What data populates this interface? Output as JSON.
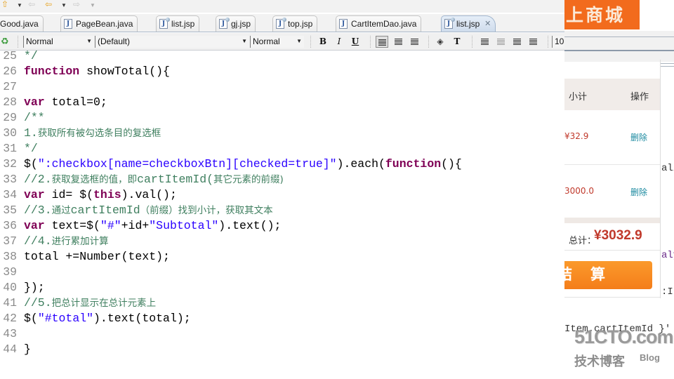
{
  "nav_toolbar": {
    "icons": [
      "up-arrow-icon",
      "back-arrow-icon",
      "forward-arrow-icon"
    ]
  },
  "tabs": [
    {
      "label": "Good.java",
      "type": "java",
      "active": false
    },
    {
      "label": "PageBean.java",
      "type": "java",
      "active": false
    },
    {
      "label": "list.jsp",
      "type": "jsp",
      "active": false
    },
    {
      "label": "gj.jsp",
      "type": "jsp",
      "active": false
    },
    {
      "label": "top.jsp",
      "type": "jsp",
      "active": false
    },
    {
      "label": "CartItemDao.java",
      "type": "java",
      "active": false
    },
    {
      "label": "list.jsp",
      "type": "jsp",
      "active": true
    }
  ],
  "format_toolbar": {
    "paragraph_style": "Normal",
    "font_family": "(Default)",
    "font_size_style": "Normal",
    "bold": "B",
    "italic": "I",
    "underline": "U",
    "font_size_value": "10"
  },
  "editor": {
    "lines": [
      {
        "n": "25",
        "tokens": [
          {
            "t": "*/",
            "c": "cmt"
          }
        ]
      },
      {
        "n": "26",
        "tokens": [
          {
            "t": "function",
            "c": "kw"
          },
          {
            "t": " showTotal(){",
            "c": ""
          }
        ]
      },
      {
        "n": "27",
        "tokens": []
      },
      {
        "n": "28",
        "tokens": [
          {
            "t": "var",
            "c": "kw"
          },
          {
            "t": " total=0;",
            "c": ""
          }
        ]
      },
      {
        "n": "29",
        "tokens": [
          {
            "t": "/**",
            "c": "cmt"
          }
        ]
      },
      {
        "n": "30",
        "tokens": [
          {
            "t": "1.",
            "c": "cmt"
          },
          {
            "t": "获取所有被勾选条目的复选框",
            "c": "cmt cn"
          }
        ]
      },
      {
        "n": "31",
        "tokens": [
          {
            "t": "*/",
            "c": "cmt"
          }
        ]
      },
      {
        "n": "32",
        "tokens": [
          {
            "t": "$(",
            "c": ""
          },
          {
            "t": "\":checkbox[name=checkboxBtn][checked=true]\"",
            "c": "str"
          },
          {
            "t": ").each(",
            "c": ""
          },
          {
            "t": "function",
            "c": "kw"
          },
          {
            "t": "(){",
            "c": ""
          }
        ]
      },
      {
        "n": "33",
        "tokens": [
          {
            "t": "//2.",
            "c": "cmt"
          },
          {
            "t": "获取复选框的值，即",
            "c": "cmt cn"
          },
          {
            "t": "cartItemId(",
            "c": "cmt"
          },
          {
            "t": "其它元素的前缀)",
            "c": "cmt cn"
          }
        ]
      },
      {
        "n": "34",
        "tokens": [
          {
            "t": "var",
            "c": "kw"
          },
          {
            "t": " id= $(",
            "c": ""
          },
          {
            "t": "this",
            "c": "kw"
          },
          {
            "t": ").val();",
            "c": ""
          }
        ]
      },
      {
        "n": "35",
        "tokens": [
          {
            "t": "//3.",
            "c": "cmt"
          },
          {
            "t": "通过",
            "c": "cmt cn"
          },
          {
            "t": "cartItemId",
            "c": "cmt"
          },
          {
            "t": "（前缀）找到小计，获取其文本",
            "c": "cmt cn"
          }
        ]
      },
      {
        "n": "36",
        "tokens": [
          {
            "t": "var",
            "c": "kw"
          },
          {
            "t": " text=$(",
            "c": ""
          },
          {
            "t": "\"#\"",
            "c": "str"
          },
          {
            "t": "+id+",
            "c": ""
          },
          {
            "t": "\"Subtotal\"",
            "c": "str"
          },
          {
            "t": ").text();",
            "c": ""
          }
        ]
      },
      {
        "n": "37",
        "tokens": [
          {
            "t": "//4.",
            "c": "cmt"
          },
          {
            "t": "进行累加计算",
            "c": "cmt cn"
          }
        ]
      },
      {
        "n": "38",
        "tokens": [
          {
            "t": "total +=Number(text);",
            "c": ""
          }
        ]
      },
      {
        "n": "39",
        "tokens": []
      },
      {
        "n": "40",
        "tokens": [
          {
            "t": "});",
            "c": ""
          }
        ]
      },
      {
        "n": "41",
        "tokens": [
          {
            "t": "//5.",
            "c": "cmt"
          },
          {
            "t": "把总计显示在总计元素上",
            "c": "cmt cn"
          }
        ]
      },
      {
        "n": "42",
        "tokens": [
          {
            "t": "$(",
            "c": ""
          },
          {
            "t": "\"#total\"",
            "c": "str"
          },
          {
            "t": ").text(total);",
            "c": ""
          }
        ]
      },
      {
        "n": "43",
        "tokens": []
      },
      {
        "n": "44",
        "tokens": [
          {
            "t": "}",
            "c": ""
          }
        ]
      }
    ]
  },
  "browser": {
    "logo_text": "上商城",
    "cart_header": {
      "subtotal": "小计",
      "operation": "操作"
    },
    "rows": [
      {
        "price": "¥32.9",
        "action": "删除"
      },
      {
        "price": "3000.0",
        "action": "删除"
      }
    ],
    "total_label": "总计：",
    "total_value": "¥3032.9",
    "checkout_label": "结算",
    "bg_code": [
      "ali",
      "aly",
      ":It",
      "Item.cartItemId }'"
    ]
  },
  "watermark": {
    "main": "51CTO.com",
    "sub": "技术博客",
    "blog": "Blog"
  }
}
